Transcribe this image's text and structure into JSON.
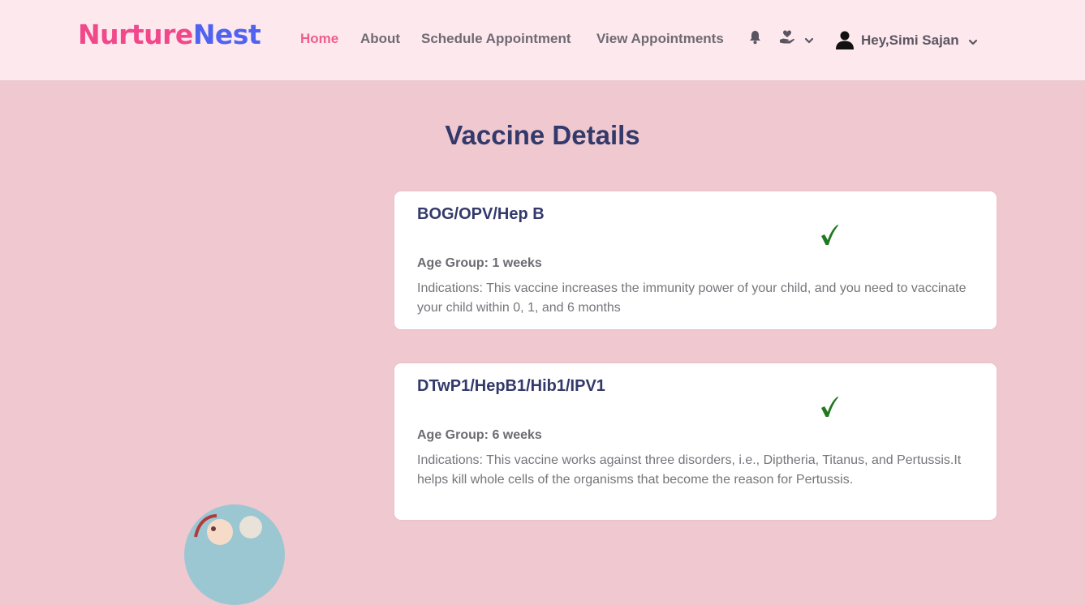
{
  "brand": {
    "part1": "Nurture",
    "part2": "Nest"
  },
  "nav": {
    "home": "Home",
    "about": "About",
    "schedule": "Schedule Appointment",
    "view": "View Appointments"
  },
  "icons": {
    "bell": "bell-icon",
    "care": "hand-heart-icon",
    "user": "user-icon"
  },
  "user": {
    "greeting": "Hey,Simi Sajan"
  },
  "page": {
    "title": "Vaccine Details"
  },
  "vaccines": [
    {
      "name": "BOG/OPV/Hep B",
      "age_group": "Age Group: 1 weeks",
      "indications": "Indications: This vaccine increases the immunity power of your child, and you need to vaccinate your child within 0, 1, and 6 months",
      "completed": true
    },
    {
      "name": "DTwP1/HepB1/Hib1/IPV1",
      "age_group": "Age Group: 6 weeks",
      "indications": "Indications: This vaccine works against three disorders, i.e., Diptheria, Titanus, and Pertussis.It helps kill whole cells of the organisms that become the reason for Pertussis.",
      "completed": true
    }
  ],
  "colors": {
    "background": "#f0c8cf",
    "navbar": "#fde8ee",
    "brand_pink": "#f0488a",
    "brand_blue": "#4f63f0",
    "active_link": "#ef5d8c",
    "heading": "#333a6b",
    "check": "#1f7a1f"
  }
}
